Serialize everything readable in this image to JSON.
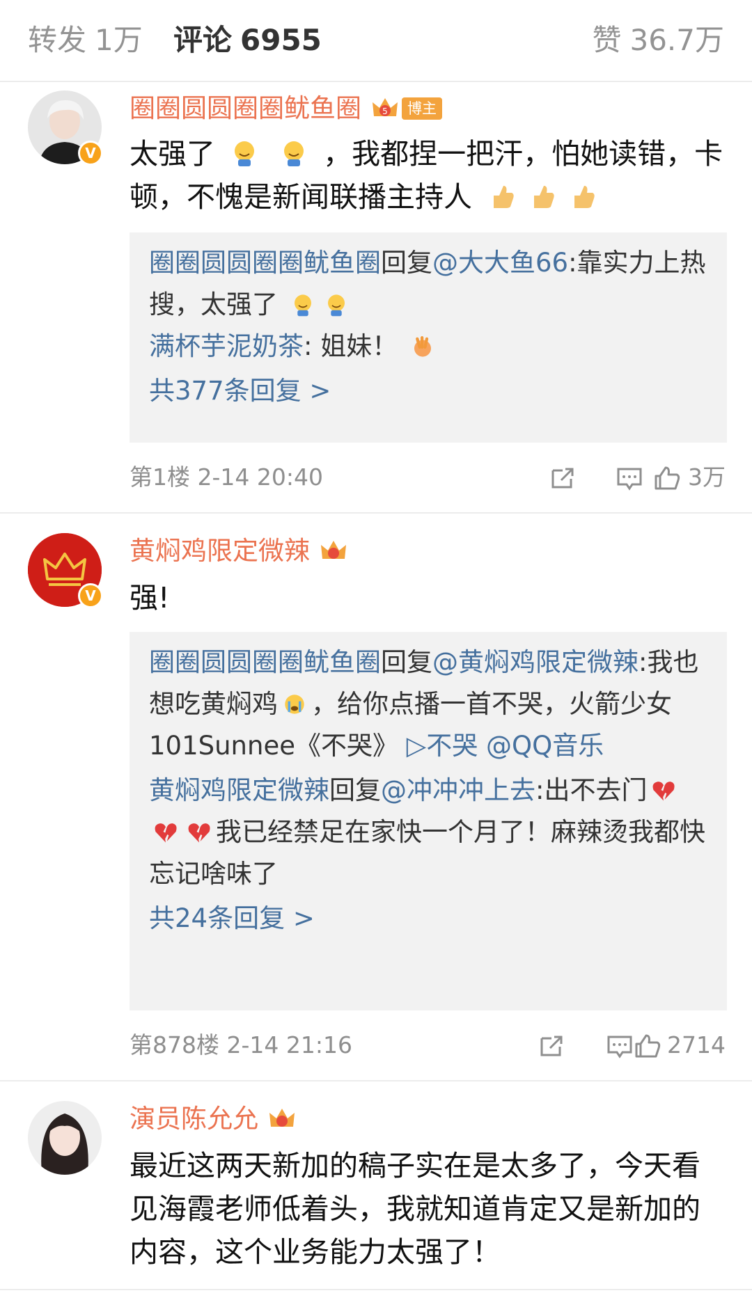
{
  "tabs": {
    "repost_label": "转发",
    "repost_count": "1万",
    "comments_label": "评论",
    "comments_count": "6955",
    "likes_label": "赞",
    "likes_count": "36.7万"
  },
  "comments": [
    {
      "username": "圈圈圆圆圈圈鱿鱼圈",
      "badge": "博主",
      "text_part1": "太强了",
      "text_part2": "，我都捏一把汗，怕她读错，卡顿，不愧是新闻联播主持人",
      "replies": [
        {
          "user": "圈圈圆圆圈圈鱿鱼圈",
          "verb": "回复",
          "target": "@大大鱼66",
          "text": ":靠实力上热搜，太强了"
        },
        {
          "user": "满杯芋泥奶茶",
          "text": ": 姐妹！"
        }
      ],
      "more_replies": "共377条回复 >",
      "floor": "第1楼",
      "time": "2-14 20:40",
      "likes": "3万"
    },
    {
      "username": "黄焖鸡限定微辣",
      "text": "强!",
      "replies": [
        {
          "user": "圈圈圆圆圈圈鱿鱼圈",
          "verb": "回复",
          "target": "@黄焖鸡限定微辣",
          "text_a": ":我也想吃黄焖鸡",
          "text_b": "，给你点播一首不哭，火箭少女101Sunnee《不哭》",
          "link_song": "▷不哭",
          "link_app": "@QQ音乐"
        },
        {
          "user": "黄焖鸡限定微辣",
          "verb": "回复",
          "target": "@冲冲冲上去",
          "text_a": ":出不去门",
          "text_b": "我已经禁足在家快一个月了！麻辣烫我都快忘记啥味了"
        }
      ],
      "more_replies": "共24条回复 >",
      "floor": "第878楼",
      "time": "2-14 21:16",
      "likes": "2714"
    },
    {
      "username": "演员陈允允",
      "text": "最近这两天新加的稿子实在是太多了，今天看见海霞老师低着头，我就知道肯定又是新加的内容，这个业务能力太强了！"
    }
  ],
  "icons": {
    "verified_badge": "V",
    "repost_icon": "share-icon",
    "comment_icon": "comment-icon",
    "like_icon": "thumbs-up-icon"
  },
  "colors": {
    "username": "#eb7350",
    "link": "#45709e",
    "muted": "#8e8e8e",
    "reply_bg": "#f2f2f2",
    "verified": "#f8a21a"
  }
}
